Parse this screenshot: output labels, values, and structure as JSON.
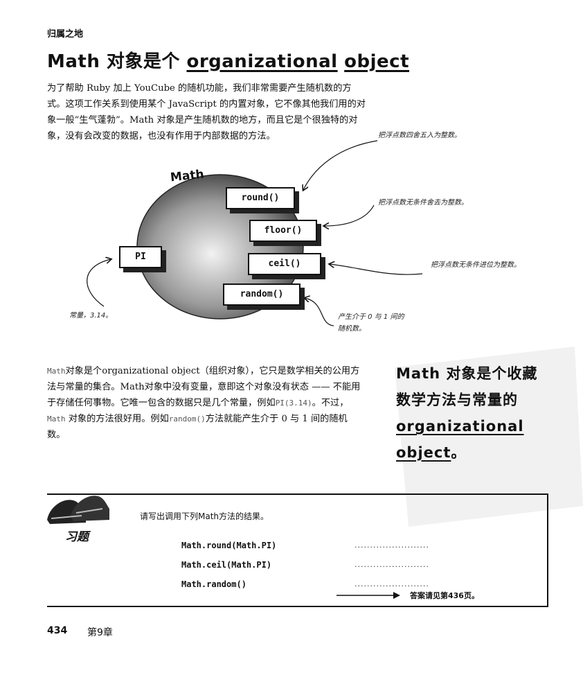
{
  "section_title": "归属之地",
  "title": {
    "prefix": "Math 对象是个 ",
    "part1": "organizational",
    "part2": "object"
  },
  "intro_paragraph": "为了帮助 Ruby 加上 YouCube 的随机功能，我们非常需要产生随机数的方式。这项工作关系到使用某个 JavaScript 的内置对象，它不像其他我们用的对象一般“生气蓬勃”。Math 对象是产生随机数的地方，而且它是个很独特的对象，没有会改变的数据，也没有作用于内部数据的方法。",
  "diagram": {
    "object_label": "Math",
    "constant": "PI",
    "methods": [
      "round()",
      "floor()",
      "ceil()",
      "random()"
    ],
    "annotations": {
      "round": "把浮点数四舍五入为整数。",
      "floor": "把浮点数无条件舍去为整数。",
      "ceil": "把浮点数无条件进位为整数。",
      "random": "产生介于 0 与 1 间的随机数。",
      "constant": "常量，3.14。"
    }
  },
  "body_paragraph": {
    "s1_code": "Math",
    "s1": "对象是个organizational object（组织对象），它只是数学相关的公用方法与常量的集合。Math对象中没有变量，意即这个对象没有状态 —— 不能用于存储任何事物。它唯一包含的数据只是几个常量，例如",
    "s2_code": "PI(3.14)",
    "s3": "。不过，",
    "s4_code": "Math",
    "s5": " 对象的方法很好用。例如",
    "s6_code": "random()",
    "s7": "方法就能产生介于 0 与 1 间的随机数。"
  },
  "callout": {
    "line1": "Math 对象是个收藏数学方法与常量的 ",
    "underlined1": "organizational",
    "underlined2": "object",
    "end": "。"
  },
  "exercise": {
    "badge": "习题",
    "instruction": "请写出调用下列Math方法的结果。",
    "items": [
      "Math.round(Math.PI)",
      "Math.ceil(Math.PI)",
      "Math.random()"
    ],
    "blank": "........................",
    "answer_note": "答案请见第436页。"
  },
  "footer": {
    "page_number": "434",
    "chapter": "第9章"
  }
}
